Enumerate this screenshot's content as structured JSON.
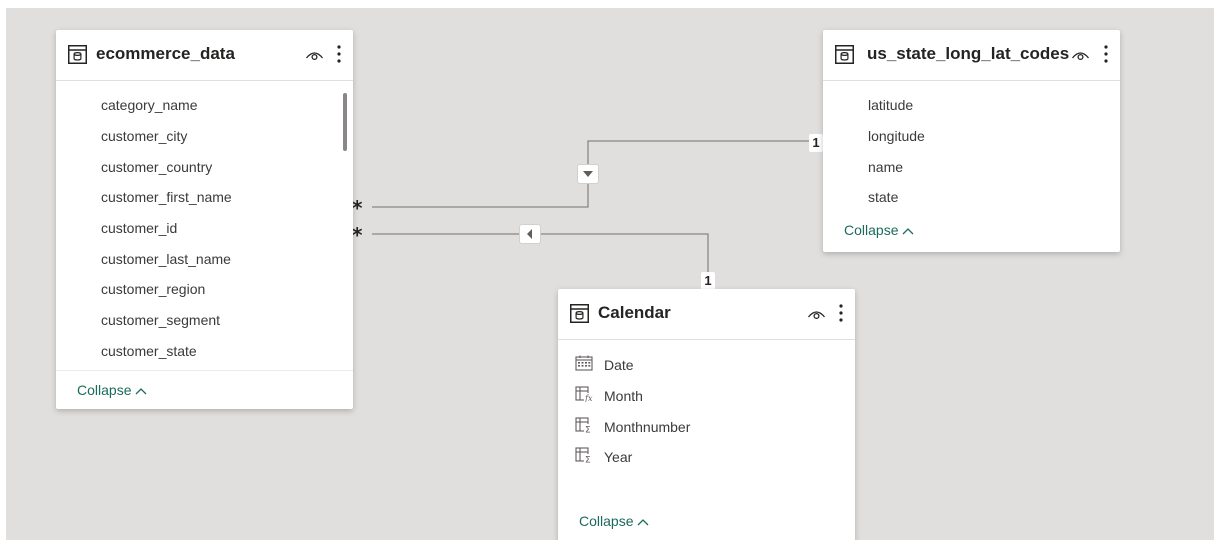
{
  "tables": {
    "ecommerce": {
      "title": "ecommerce_data",
      "fields": [
        "category_name",
        "customer_city",
        "customer_country",
        "customer_first_name",
        "customer_id",
        "customer_last_name",
        "customer_region",
        "customer_segment",
        "customer_state"
      ],
      "collapse_label": "Collapse"
    },
    "us_state": {
      "title": "us_state_long_lat_codes",
      "fields": [
        "latitude",
        "longitude",
        "name",
        "state"
      ],
      "collapse_label": "Collapse"
    },
    "calendar": {
      "title": "Calendar",
      "fields": [
        {
          "label": "Date",
          "icon": "calendar-icon"
        },
        {
          "label": "Month",
          "icon": "calculated-column-icon"
        },
        {
          "label": "Monthnumber",
          "icon": "calculated-column-sigma-icon"
        },
        {
          "label": "Year",
          "icon": "calculated-column-sigma-icon"
        }
      ],
      "collapse_label": "Collapse"
    }
  },
  "relationships": [
    {
      "from": "ecommerce_data",
      "to": "us_state_long_lat_codes",
      "from_cardinality": "*",
      "to_cardinality": "1",
      "filter_direction": "down-arrow-icon"
    },
    {
      "from": "ecommerce_data",
      "to": "Calendar",
      "from_cardinality": "*",
      "to_cardinality": "1",
      "filter_direction": "left-arrow-icon"
    }
  ],
  "colors": {
    "canvas": "#e1dfdd",
    "card": "#ffffff",
    "collapse_link": "#1b6b5c",
    "line": "#8a8886"
  }
}
